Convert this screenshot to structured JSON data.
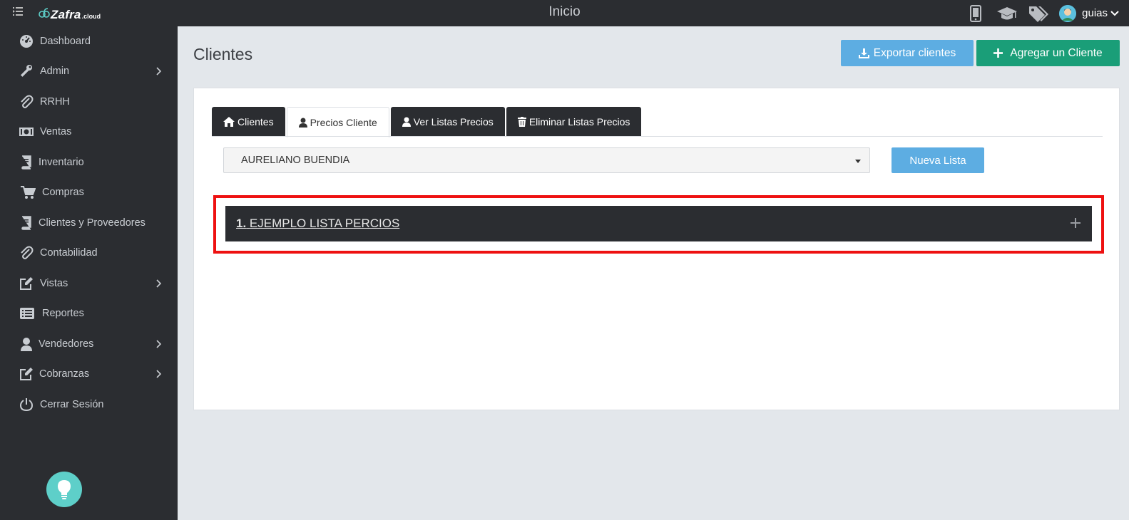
{
  "topbar": {
    "logo_main": "Zafra",
    "logo_sub": ".cloud",
    "page_heading": "Inicio",
    "user_name": "guias"
  },
  "sidebar": {
    "items": [
      {
        "label": "Dashboard",
        "icon": "dashboard-icon",
        "has_arrow": false
      },
      {
        "label": "Admin",
        "icon": "wrench-icon",
        "has_arrow": true
      },
      {
        "label": "RRHH",
        "icon": "paperclip-icon",
        "has_arrow": false
      },
      {
        "label": "Ventas",
        "icon": "money-icon",
        "has_arrow": false
      },
      {
        "label": "Inventario",
        "icon": "book-icon",
        "has_arrow": false
      },
      {
        "label": "Compras",
        "icon": "cart-icon",
        "has_arrow": false
      },
      {
        "label": "Clientes y Proveedores",
        "icon": "book-icon",
        "has_arrow": false
      },
      {
        "label": "Contabilidad",
        "icon": "paperclip-icon",
        "has_arrow": false
      },
      {
        "label": "Vistas",
        "icon": "edit-icon",
        "has_arrow": true
      },
      {
        "label": "Reportes",
        "icon": "list-icon",
        "has_arrow": false
      },
      {
        "label": "Vendedores",
        "icon": "user-icon",
        "has_arrow": true
      },
      {
        "label": "Cobranzas",
        "icon": "edit-icon",
        "has_arrow": true
      },
      {
        "label": "Cerrar Sesión",
        "icon": "power-icon",
        "has_arrow": false
      }
    ]
  },
  "content": {
    "title": "Clientes",
    "export_label": "Exportar clientes",
    "add_label": "Agregar un Cliente"
  },
  "tabs": [
    {
      "label": "Clientes",
      "icon": "home-icon",
      "active": false
    },
    {
      "label": "Precios Cliente",
      "icon": "user-icon",
      "active": true
    },
    {
      "label": "Ver Listas Precios",
      "icon": "user-icon",
      "active": false
    },
    {
      "label": "Eliminar Listas Precios",
      "icon": "trash-icon",
      "active": false
    }
  ],
  "client_select": {
    "value": "AURELIANO BUENDIA"
  },
  "new_list_label": "Nueva Lista",
  "price_list": {
    "number": "1.",
    "name": "EJEMPLO LISTA PERCIOS"
  },
  "colors": {
    "dark": "#2b2d31",
    "accent_blue": "#5dade2",
    "accent_green": "#1a9e78",
    "highlight_red": "#ee1111"
  }
}
